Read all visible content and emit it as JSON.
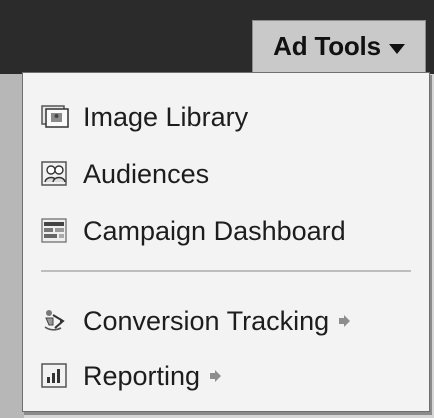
{
  "header": {
    "ad_tools_label": "Ad Tools"
  },
  "menu": {
    "items": [
      {
        "label": "Image Library",
        "icon": "image-library-icon"
      },
      {
        "label": "Audiences",
        "icon": "audiences-icon"
      },
      {
        "label": "Campaign Dashboard",
        "icon": "campaign-dashboard-icon"
      },
      {
        "label": "Conversion Tracking",
        "icon": "conversion-tracking-icon",
        "has_arrow": true
      },
      {
        "label": "Reporting",
        "icon": "reporting-icon",
        "has_arrow": true
      }
    ]
  },
  "colors": {
    "topbar": "#2b2b2b",
    "button_bg": "#c9c9c9",
    "menu_bg": "#f3f3f3",
    "text": "#1d1d1d"
  }
}
